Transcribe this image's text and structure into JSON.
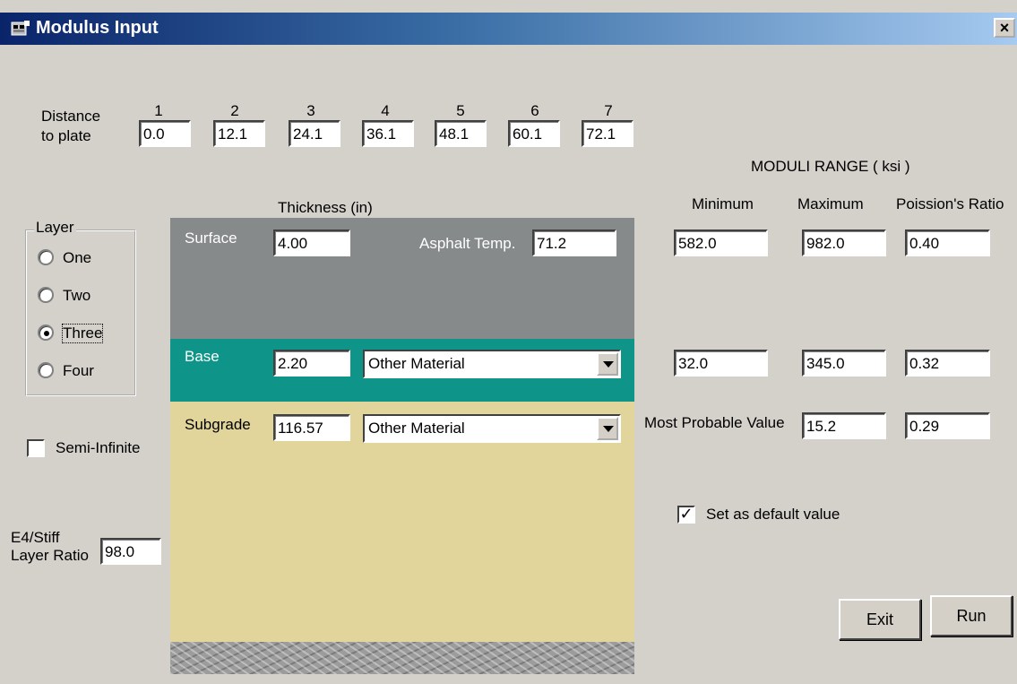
{
  "window": {
    "title": "Modulus Input",
    "close_glyph": "×"
  },
  "distance": {
    "label_line1": "Distance",
    "label_line2": "to plate",
    "sensors": [
      {
        "num": "1",
        "value": "0.0"
      },
      {
        "num": "2",
        "value": "12.1"
      },
      {
        "num": "3",
        "value": "24.1"
      },
      {
        "num": "4",
        "value": "36.1"
      },
      {
        "num": "5",
        "value": "48.1"
      },
      {
        "num": "6",
        "value": "60.1"
      },
      {
        "num": "7",
        "value": "72.1"
      }
    ]
  },
  "layer_group": {
    "legend": "Layer",
    "options": [
      "One",
      "Two",
      "Three",
      "Four"
    ],
    "selected": "Three"
  },
  "semi_infinite": {
    "label": "Semi-Infinite",
    "checked": false
  },
  "stiff_ratio": {
    "label_line1": "E4/Stiff",
    "label_line2": "Layer Ratio",
    "value": "98.0"
  },
  "thickness_header": "Thickness (in)",
  "layers": {
    "surface": {
      "name": "Surface",
      "thickness": "4.00",
      "temp_label": "Asphalt Temp.",
      "temp_value": "71.2"
    },
    "base": {
      "name": "Base",
      "thickness": "2.20",
      "material": "Other Material"
    },
    "subgrade": {
      "name": "Subgrade",
      "thickness": "116.57",
      "material": "Other Material"
    }
  },
  "moduli": {
    "header": "MODULI RANGE  ( ksi )",
    "col_min": "Minimum",
    "col_max": "Maximum",
    "col_ratio": "Poission's Ratio",
    "surface": {
      "min": "582.0",
      "max": "982.0",
      "ratio": "0.40"
    },
    "base": {
      "min": "32.0",
      "max": "345.0",
      "ratio": "0.32"
    },
    "subgrade": {
      "mpv_label": "Most Probable Value",
      "mpv": "15.2",
      "ratio": "0.29"
    }
  },
  "default_value": {
    "label": "Set as default value",
    "checked": true
  },
  "buttons": {
    "exit": "Exit",
    "run": "Run"
  },
  "colors": {
    "title_start": "#0a246a",
    "surface_layer": "#878a8a",
    "base_layer": "#0e9488",
    "subgrade_layer": "#e2d59c",
    "dialog_bg": "#d4d1cb"
  }
}
